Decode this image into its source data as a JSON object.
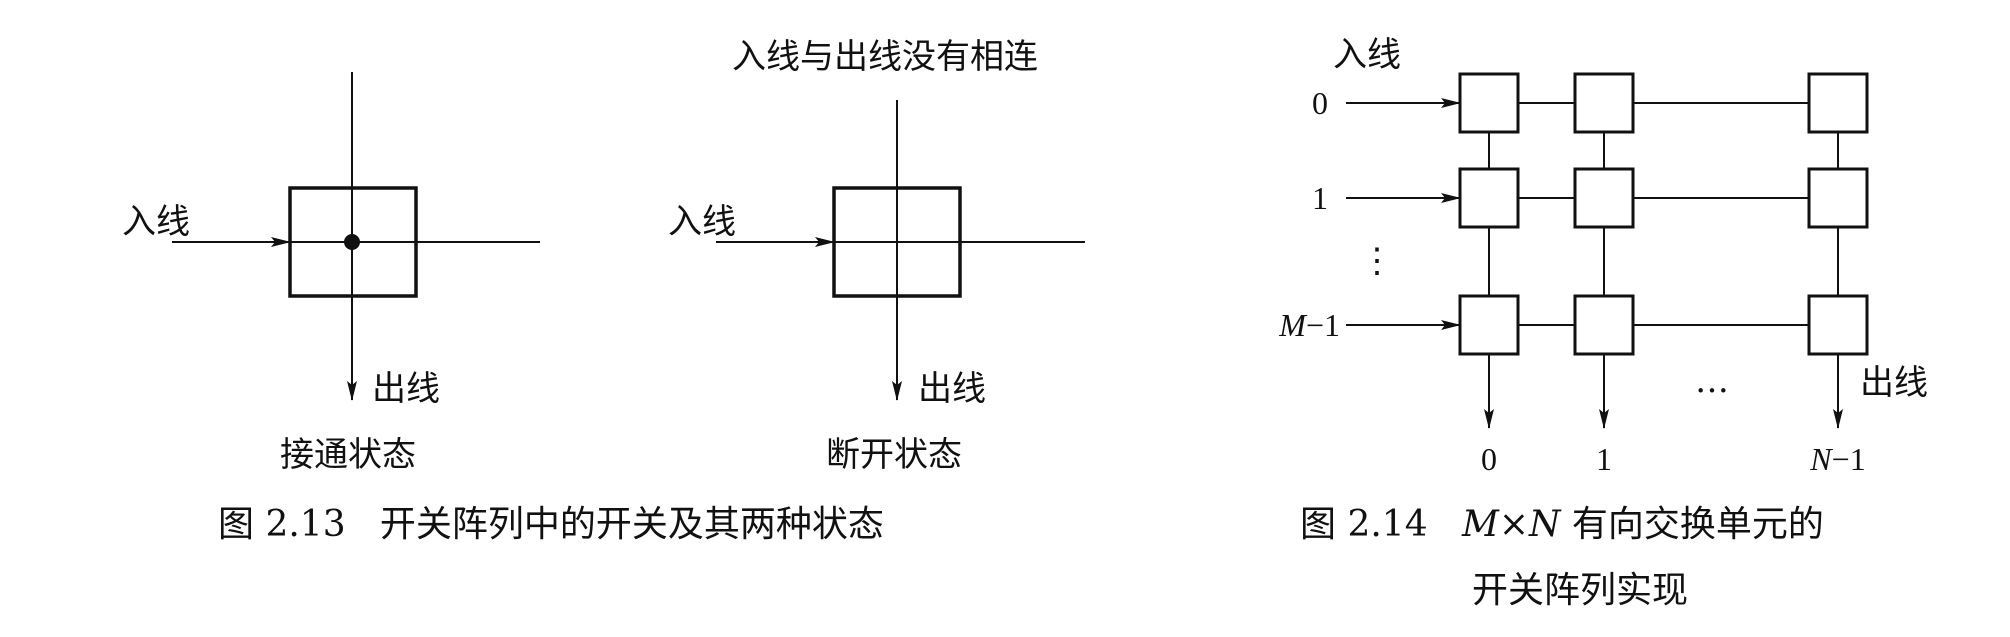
{
  "fig13": {
    "left": {
      "input": "入线",
      "output": "出线",
      "state": "接通状态"
    },
    "right": {
      "note": "入线与出线没有相连",
      "input": "入线",
      "output": "出线",
      "state": "断开状态"
    },
    "caption": "图 2.13   开关阵列中的开关及其两种状态"
  },
  "fig14": {
    "input_label": "入线",
    "output_label": "出线",
    "rows": [
      {
        "label": "0"
      },
      {
        "label": "1"
      },
      {
        "label": "M−1",
        "var": "M",
        "suffix": "−1"
      }
    ],
    "columns": [
      {
        "label": "0"
      },
      {
        "label": "1"
      },
      {
        "label": "N−1",
        "var": "N",
        "suffix": "−1"
      }
    ],
    "vdots": "⋮",
    "hdots": "…",
    "caption_prefix": "图 2.14   ",
    "caption_var1": "M",
    "caption_times": "×",
    "caption_var2": "N",
    "caption_rest": " 有向交换单元的",
    "caption_line2": "开关阵列实现"
  }
}
